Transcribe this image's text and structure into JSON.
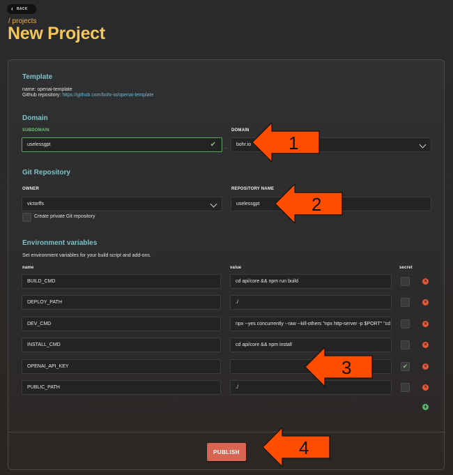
{
  "back": {
    "label": "BACK"
  },
  "breadcrumb": "/ projects",
  "title": "New Project",
  "template": {
    "heading": "Template",
    "name_line": "name: openai-template",
    "repo_prefix": "Github repository: ",
    "repo_link": "https://github.com/bohr-io/openai-template"
  },
  "domain": {
    "heading": "Domain",
    "subdomain_label": "SUBDOMAIN",
    "subdomain_value": "uselessgpt",
    "separator": ".",
    "domain_label": "DOMAIN",
    "domain_value": "bohr.io"
  },
  "git": {
    "heading": "Git Repository",
    "owner_label": "OWNER",
    "owner_value": "victorffs",
    "repo_label": "REPOSITORY NAME",
    "repo_value": "uselessgpt",
    "private_label": "Create private Git repository"
  },
  "env": {
    "heading": "Environment variables",
    "description": "Set environment variables for your build script and add-ons.",
    "col_name": "name",
    "col_value": "value",
    "col_secret": "secret",
    "rows": [
      {
        "name": "BUILD_CMD",
        "value": "cd api/core && npm run build",
        "secret": false
      },
      {
        "name": "DEPLOY_PATH",
        "value": "./",
        "secret": false
      },
      {
        "name": "DEV_CMD",
        "value": "npx --yes concurrently --raw --kill-others \"npx http-server -p $PORT\" \"cd ap",
        "secret": false
      },
      {
        "name": "INSTALL_CMD",
        "value": "cd api/core && npm install",
        "secret": false
      },
      {
        "name": "OPENAI_API_KEY",
        "value": "",
        "secret": true
      },
      {
        "name": "PUBLIC_PATH",
        "value": "./",
        "secret": false
      }
    ]
  },
  "publish_label": "PUBLISH",
  "annotations": [
    "1",
    "2",
    "3",
    "4"
  ],
  "icons": {
    "back": "chevron-left-icon",
    "valid": "check-icon",
    "select": "chevron-down-icon",
    "delete": "delete-circle-icon",
    "add": "add-circle-icon"
  },
  "colors": {
    "title": "#f3c65b",
    "section_heading": "#7ec3c7",
    "publish": "#d96452",
    "annotation_arrow": "#ff4d00",
    "delete": "#e05a3a",
    "add": "#4fbf6c"
  }
}
